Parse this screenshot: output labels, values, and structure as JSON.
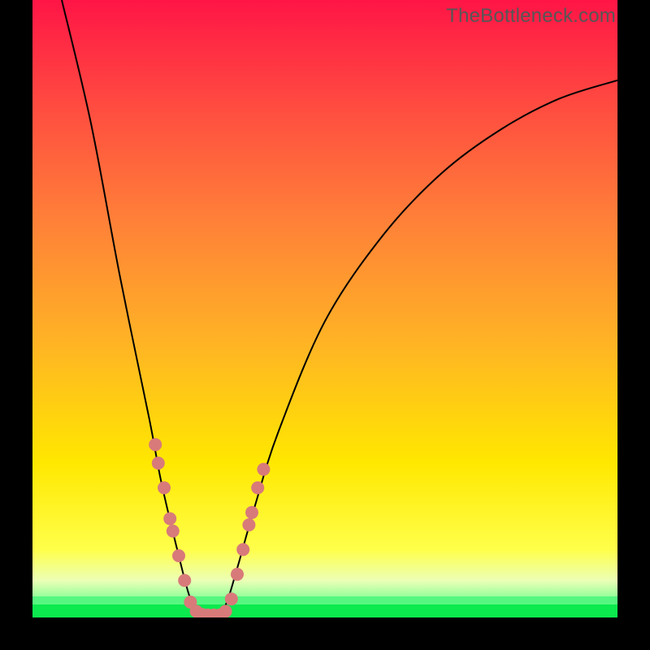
{
  "watermark": "TheBottleneck.com",
  "chart_data": {
    "type": "line",
    "title": "",
    "xlabel": "",
    "ylabel": "",
    "xlim": [
      0,
      100
    ],
    "ylim": [
      0,
      100
    ],
    "grid": false,
    "legend": false,
    "description": "Bottleneck curve: y-axis is bottleneck percentage (red=high, green=low). V-shaped curve reaches minimum (~0%) near x≈30, rising steeply on both sides.",
    "series": [
      {
        "name": "bottleneck-curve",
        "x": [
          5,
          10,
          15,
          20,
          22,
          25,
          27,
          29,
          31,
          33,
          35,
          38,
          42,
          50,
          60,
          70,
          80,
          90,
          100
        ],
        "y": [
          100,
          80,
          55,
          32,
          22,
          10,
          3,
          0,
          0,
          2,
          8,
          18,
          30,
          48,
          62,
          72,
          79,
          84,
          87
        ]
      }
    ],
    "markers": {
      "name": "highlight-dots",
      "color": "#d87a7a",
      "points": [
        {
          "x": 21.0,
          "y": 28
        },
        {
          "x": 21.5,
          "y": 25
        },
        {
          "x": 22.5,
          "y": 21
        },
        {
          "x": 23.5,
          "y": 16
        },
        {
          "x": 24.0,
          "y": 14
        },
        {
          "x": 25.0,
          "y": 10
        },
        {
          "x": 26.0,
          "y": 6
        },
        {
          "x": 27.0,
          "y": 2.5
        },
        {
          "x": 28.0,
          "y": 1
        },
        {
          "x": 29.0,
          "y": 0.5
        },
        {
          "x": 30.0,
          "y": 0.4
        },
        {
          "x": 31.0,
          "y": 0.4
        },
        {
          "x": 32.0,
          "y": 0.4
        },
        {
          "x": 33.0,
          "y": 1
        },
        {
          "x": 34.0,
          "y": 3
        },
        {
          "x": 35.0,
          "y": 7
        },
        {
          "x": 36.0,
          "y": 11
        },
        {
          "x": 37.0,
          "y": 15
        },
        {
          "x": 37.5,
          "y": 17
        },
        {
          "x": 38.5,
          "y": 21
        },
        {
          "x": 39.5,
          "y": 24
        }
      ]
    }
  }
}
